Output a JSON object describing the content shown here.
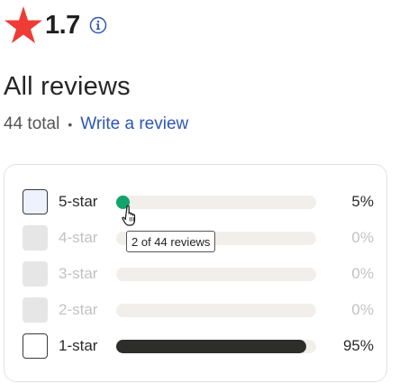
{
  "rating": {
    "value": "1.7",
    "star_color": "#ee3b35",
    "star_icon": "star-icon",
    "info_icon": "info-circle-icon"
  },
  "reviews": {
    "title": "All reviews",
    "total_label": "44 total",
    "separator": "•",
    "write_link": "Write a review"
  },
  "breakdown": {
    "rows": [
      {
        "label": "5-star",
        "percent_label": "5%",
        "percent": 5,
        "enabled": true,
        "hovered": true
      },
      {
        "label": "4-star",
        "percent_label": "0%",
        "percent": 0,
        "enabled": false
      },
      {
        "label": "3-star",
        "percent_label": "0%",
        "percent": 0,
        "enabled": false
      },
      {
        "label": "2-star",
        "percent_label": "0%",
        "percent": 0,
        "enabled": false
      },
      {
        "label": "1-star",
        "percent_label": "95%",
        "percent": 95,
        "enabled": true
      }
    ],
    "tooltip": "2 of 44 reviews"
  },
  "colors": {
    "accent_link": "#2f55b5",
    "bar_fill": "#2d2d2a",
    "bar_hover_marker": "#13a36d",
    "bar_track": "#f2efea"
  }
}
